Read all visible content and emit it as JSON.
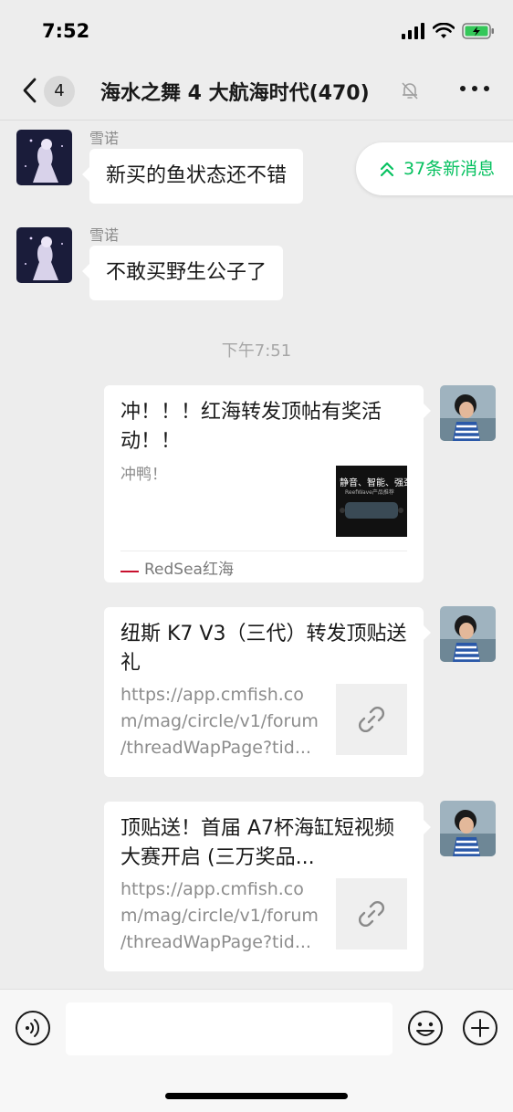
{
  "status_bar": {
    "time": "7:52"
  },
  "nav": {
    "unread_count": "4",
    "title": "海水之舞 4 大航海时代(470)"
  },
  "new_messages_pill": "37条新消息",
  "messages_top": [
    {
      "sender": "雪诺",
      "text": "新买的鱼状态还不错"
    },
    {
      "sender": "雪诺",
      "text": "不敢买野生公子了"
    }
  ],
  "time_divider": "下午7:51",
  "cards": [
    {
      "title": "冲！！！红海转发顶帖有奖活动！！",
      "desc": "冲鸭！",
      "thumb_text_1": "静音、智能、强劲",
      "thumb_text_2": "ReefWave产品推荐",
      "source": "RedSea红海"
    },
    {
      "title": "纽斯 K7 V3（三代）转发顶贴送礼",
      "desc_lines": [
        "https://app.cmfish.co",
        "m/mag/circle/v1/forum",
        "/threadWapPage?tid..."
      ]
    },
    {
      "title": "顶贴送！首届 A7杯海缸短视频大赛开启 (三万奖品...",
      "desc_lines": [
        "https://app.cmfish.co",
        "m/mag/circle/v1/forum",
        "/threadWapPage?tid..."
      ]
    }
  ],
  "colors": {
    "accent_green": "#07c160",
    "background": "#ededed"
  },
  "icons": [
    "back-chevron-icon",
    "mute-bell-icon",
    "more-icon",
    "voice-icon",
    "emoji-icon",
    "plus-icon",
    "link-icon"
  ]
}
